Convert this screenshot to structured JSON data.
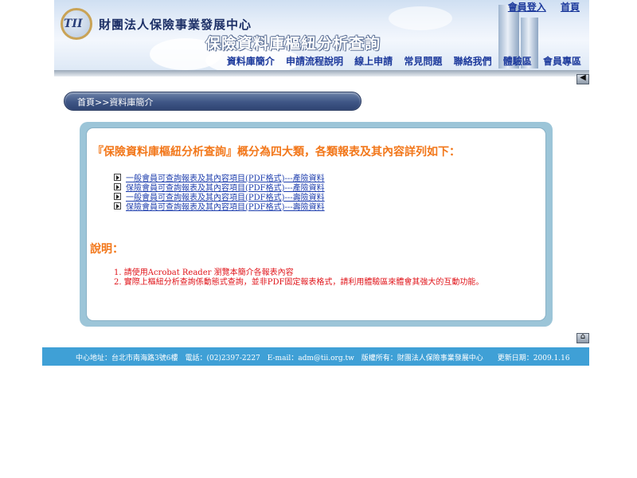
{
  "header": {
    "logo_mark": "TII",
    "org_name": "財團法人保險事業發展中心",
    "system_title": "保險資料庫樞紐分析查詢",
    "top_links": [
      "會員登入",
      "首頁"
    ],
    "nav": [
      "資料庫簡介",
      "申請流程說明",
      "線上申請",
      "常見問題",
      "聯絡我們",
      "體驗區",
      "會員專區"
    ]
  },
  "back_icon": "back-arrow-icon",
  "home_icon": "home-icon",
  "breadcrumb": "首頁>>資料庫簡介",
  "intro": "『保險資料庫樞紐分析查詢』概分為四大類，各類報表及其內容詳列如下：",
  "reports": [
    "一般會員可查詢報表及其內容項目(PDF格式)---產險資料",
    "保險會員可查詢報表及其內容項目(PDF格式)---產險資料",
    "一般會員可查詢報表及其內容項目(PDF格式)---壽險資料",
    "保險會員可查詢報表及其內容項目(PDF格式)---壽險資料"
  ],
  "notes_title": "說明：",
  "notes": [
    "1. 請使用Acrobat Reader 瀏覽本簡介各報表內容",
    "2. 實際上樞紐分析查詢係動態式查詢，並非PDF固定報表格式，請利用體驗區來體會其強大的互動功能。"
  ],
  "footer": "中心地址：台北市南海路3號6樓　電話：(02)2397-2227　E-mail：adm@tii.org.tw　版權所有：財團法人保險事業發展中心　　更新日期：2009.1.16",
  "colors": {
    "accent_orange": "#f2771a",
    "link_blue": "#1f3fae",
    "note_red": "#e0141a",
    "footer_bg": "#3fa0d6",
    "breadcrumb_bg": "#3f5686"
  }
}
